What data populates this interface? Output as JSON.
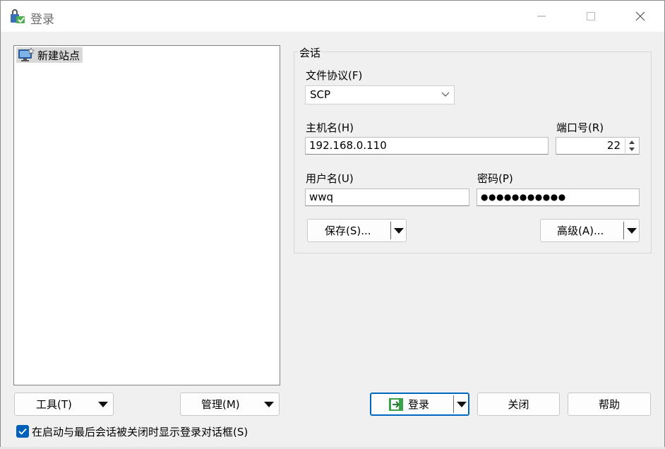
{
  "window": {
    "title": "登录",
    "minimize_icon": "minimize-icon",
    "maximize_icon": "maximize-icon",
    "close_icon": "close-icon"
  },
  "site_tree": {
    "items": [
      {
        "label": "新建站点",
        "icon": "computer-star-icon",
        "selected": true
      }
    ]
  },
  "session": {
    "group_label": "会话",
    "protocol_label": "文件协议(F)",
    "protocol_value": "SCP",
    "host_label": "主机名(H)",
    "host_value": "192.168.0.110",
    "port_label": "端口号(R)",
    "port_value": "22",
    "user_label": "用户名(U)",
    "user_value": "wwq",
    "password_label": "密码(P)",
    "password_value": "●●●●●●●●●●●",
    "save_label": "保存(S)...",
    "advanced_label": "高级(A)..."
  },
  "footer": {
    "tools_label": "工具(T)",
    "manage_label": "管理(M)",
    "login_label": "登录",
    "close_label": "关闭",
    "help_label": "帮助",
    "startup_checkbox_label": "在启动与最后会话被关闭时显示登录对话框(S)",
    "startup_checkbox_checked": true
  },
  "colors": {
    "accent": "#0067c0",
    "checkbox": "#005fb8",
    "selection": "#d9d9d9"
  }
}
